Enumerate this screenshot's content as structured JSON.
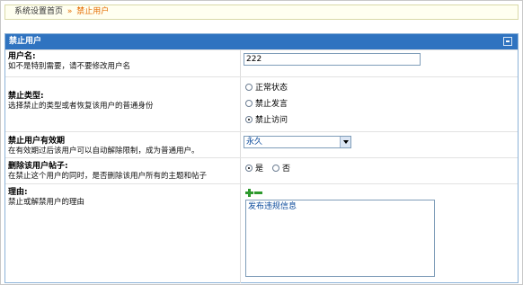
{
  "breadcrumb": {
    "home": "系统设置首页",
    "separator": "»",
    "current": "禁止用户"
  },
  "panel": {
    "title": "禁止用户",
    "collapse_icon": "minus-square-icon"
  },
  "form": {
    "username": {
      "title": "用户名:",
      "desc": "如不是特别需要，请不要修改用户名",
      "value": "222"
    },
    "ban_type": {
      "title": "禁止类型:",
      "desc": "选择禁止的类型或者恢复该用户的普通身份",
      "options": [
        {
          "label": "正常状态",
          "selected": false
        },
        {
          "label": "禁止发言",
          "selected": false
        },
        {
          "label": "禁止访问",
          "selected": true
        }
      ]
    },
    "duration": {
      "title": "禁止用户有效期",
      "desc": "在有效期过后该用户可以自动解除限制，成为普通用户。",
      "selected": "永久"
    },
    "delete_posts": {
      "title": "删除该用户帖子:",
      "desc": "在禁止这个用户的同时，是否删除该用户所有的主题和帖子",
      "options": [
        {
          "label": "是",
          "selected": true
        },
        {
          "label": "否",
          "selected": false
        }
      ]
    },
    "reason": {
      "title": "理由:",
      "desc": "禁止或解禁用户的理由",
      "value": "发布违规信息",
      "add_icon": "plus-icon",
      "remove_icon": "minus-icon"
    }
  },
  "colors": {
    "header_bg": "#2f73c0",
    "breadcrumb_current": "#e56c00",
    "value_text": "#0b4a9b"
  }
}
